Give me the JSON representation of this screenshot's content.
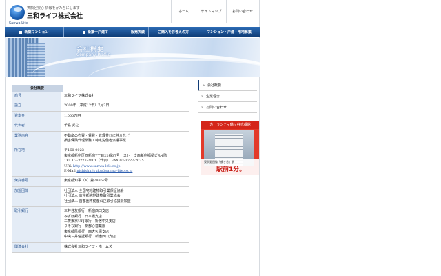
{
  "header": {
    "logo_sub": "Sanwa Life",
    "tagline": "笑顔と安心  情報をかたちにします",
    "brand": "三和ライフ株式会社",
    "nav": [
      "ホーム",
      "サイトマップ",
      "お問い合わせ"
    ]
  },
  "main_nav": [
    "新築マンション",
    "新築一戸建て",
    "販売実績",
    "ご購入をお考えの方",
    "マンション・戸建・用地募集"
  ],
  "banner": {
    "title": "会社概要",
    "subtitle": "Company Profile"
  },
  "section_tab": "会社概要",
  "rows": [
    {
      "key": "商号",
      "lines": [
        "三和ライフ株式会社"
      ]
    },
    {
      "key": "設立",
      "lines": [
        "2000年（平成12年）7月3日"
      ]
    },
    {
      "key": "資本金",
      "lines": [
        "1,000万円"
      ]
    },
    {
      "key": "代表者",
      "lines": [
        "千島 秀之"
      ]
    },
    {
      "key": "業務内容",
      "lines": [
        "不動産の売買・賃貸・管理並びに仲介など",
        "損害保険代理業務・特定労働者派遣事業"
      ]
    },
    {
      "key": "所在地",
      "lines": [
        "〒160-0023",
        "東京都新宿区西新宿7丁目22番37号　ストーク西新宿福星ビル4階",
        "TEL 03-3227-2001（代表）  FAX 03-3227-2035"
      ],
      "url_label": "URL ",
      "url": "http://www.sanwa-life.co.jp",
      "mail_label": "E-Mail ",
      "mail": "nishishinjyuku@sanwa-life.co.jp"
    },
    {
      "key": "免許番号",
      "lines": [
        "東京都知事（4）第78857号"
      ]
    },
    {
      "key": "加盟団体",
      "lines": [
        "社団法人 全国宅地建物取引業保証協会",
        "社団法人 東京都宅地建物取引業協会",
        "社団法人 首都圏不動産公正取引協議会加盟"
      ]
    },
    {
      "key": "取引銀行",
      "lines": [
        "三井住友銀行　新宿西口支店",
        "みずほ銀行　日本橋支店",
        "三菱東京UFJ銀行　新宿中央支店",
        "りそな銀行　新都心営業部",
        "東京都民銀行　西大久保支店",
        "中央三井信託銀行　新宿西口支店"
      ]
    },
    {
      "key": "関連会社",
      "lines": [
        "株式会社三和ライフ・ホームズ"
      ]
    }
  ],
  "sidebar": [
    "会社概要",
    "企業理念",
    "お問い合わせ"
  ],
  "ad": {
    "head": "カーラシティ鶴ヶ谷弐番館",
    "small": "東武野田線「鶴ヶ谷」駅",
    "big": "駅前1分。"
  }
}
